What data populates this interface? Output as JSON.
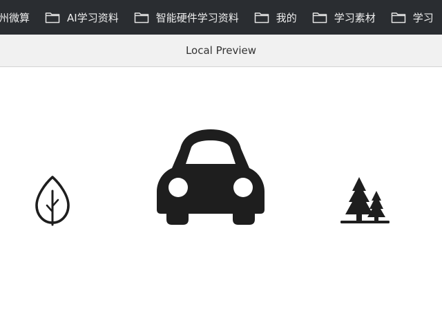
{
  "bookmarks_bar": {
    "items": [
      {
        "label": "州微算",
        "icon": null
      },
      {
        "label": "AI学习资料",
        "icon": "folder-icon"
      },
      {
        "label": "智能硬件学习资料",
        "icon": "folder-icon"
      },
      {
        "label": "我的",
        "icon": "folder-icon"
      },
      {
        "label": "学习素材",
        "icon": "folder-icon"
      },
      {
        "label": "学习",
        "icon": "folder-icon"
      }
    ]
  },
  "preview": {
    "title": "Local Preview"
  },
  "scene": {
    "icons": [
      "tree-outline-icon",
      "car-icon",
      "pine-trees-icon"
    ],
    "foreground_color": "#1e1e1e",
    "background_color": "#ffffff"
  }
}
